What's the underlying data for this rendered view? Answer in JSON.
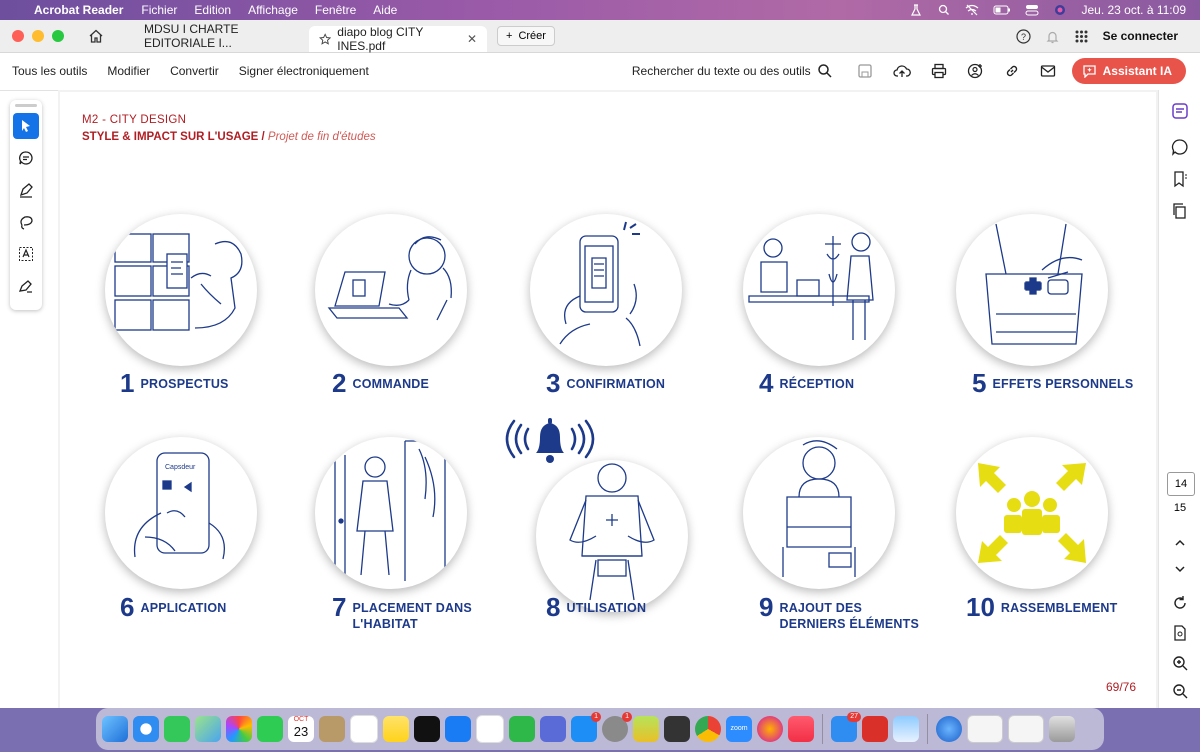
{
  "menubar": {
    "app_name": "Acrobat Reader",
    "items": [
      "Fichier",
      "Edition",
      "Affichage",
      "Fenêtre",
      "Aide"
    ],
    "datetime": "Jeu. 23 oct. à 11:09"
  },
  "tabs": {
    "inactive_title": "MDSU I CHARTE EDITORIALE I...",
    "active_title": "diapo blog CITY INES.pdf",
    "new_tab_label": "Créer",
    "sign_in": "Se connecter"
  },
  "toolbar": {
    "all_tools": "Tous les outils",
    "edit": "Modifier",
    "convert": "Convertir",
    "sign": "Signer électroniquement",
    "search": "Rechercher du texte ou des outils",
    "ai_assistant": "Assistant IA"
  },
  "document": {
    "header_line1": "M2 - CITY DESIGN",
    "header_bold": "STYLE & IMPACT SUR L'USAGE",
    "header_slash": "/",
    "header_italic": "Projet de fin d'études",
    "steps": [
      {
        "num": "1",
        "label": "PROSPECTUS"
      },
      {
        "num": "2",
        "label": "COMMANDE"
      },
      {
        "num": "3",
        "label": "CONFIRMATION"
      },
      {
        "num": "4",
        "label": "RÉCEPTION"
      },
      {
        "num": "5",
        "label": "EFFETS PERSONNELS"
      },
      {
        "num": "6",
        "label": "APPLICATION"
      },
      {
        "num": "7",
        "label": "PLACEMENT DANS L'HABITAT"
      },
      {
        "num": "8",
        "label": "UTILISATION"
      },
      {
        "num": "9",
        "label": "RAJOUT DES DERNIERS ÉLÉMENTS"
      },
      {
        "num": "10",
        "label": "RASSEMBLEMENT"
      }
    ],
    "app_screen_text": "Capsdeur",
    "page_counter": "69/76"
  },
  "rightrail": {
    "current_page": "14",
    "next_page": "15"
  },
  "dock": {
    "calendar_month": "OCT",
    "calendar_day": "23",
    "appstore_badge": "1",
    "settings_badge": "1",
    "mail_badge": "27",
    "zoom_label": "zoom"
  },
  "colors": {
    "brand_red": "#b01e23",
    "illustration_blue": "#1d3a8a",
    "accent_yellow": "#e6dd12",
    "ai_button": "#e8534a",
    "selected_tool": "#1473e6"
  }
}
